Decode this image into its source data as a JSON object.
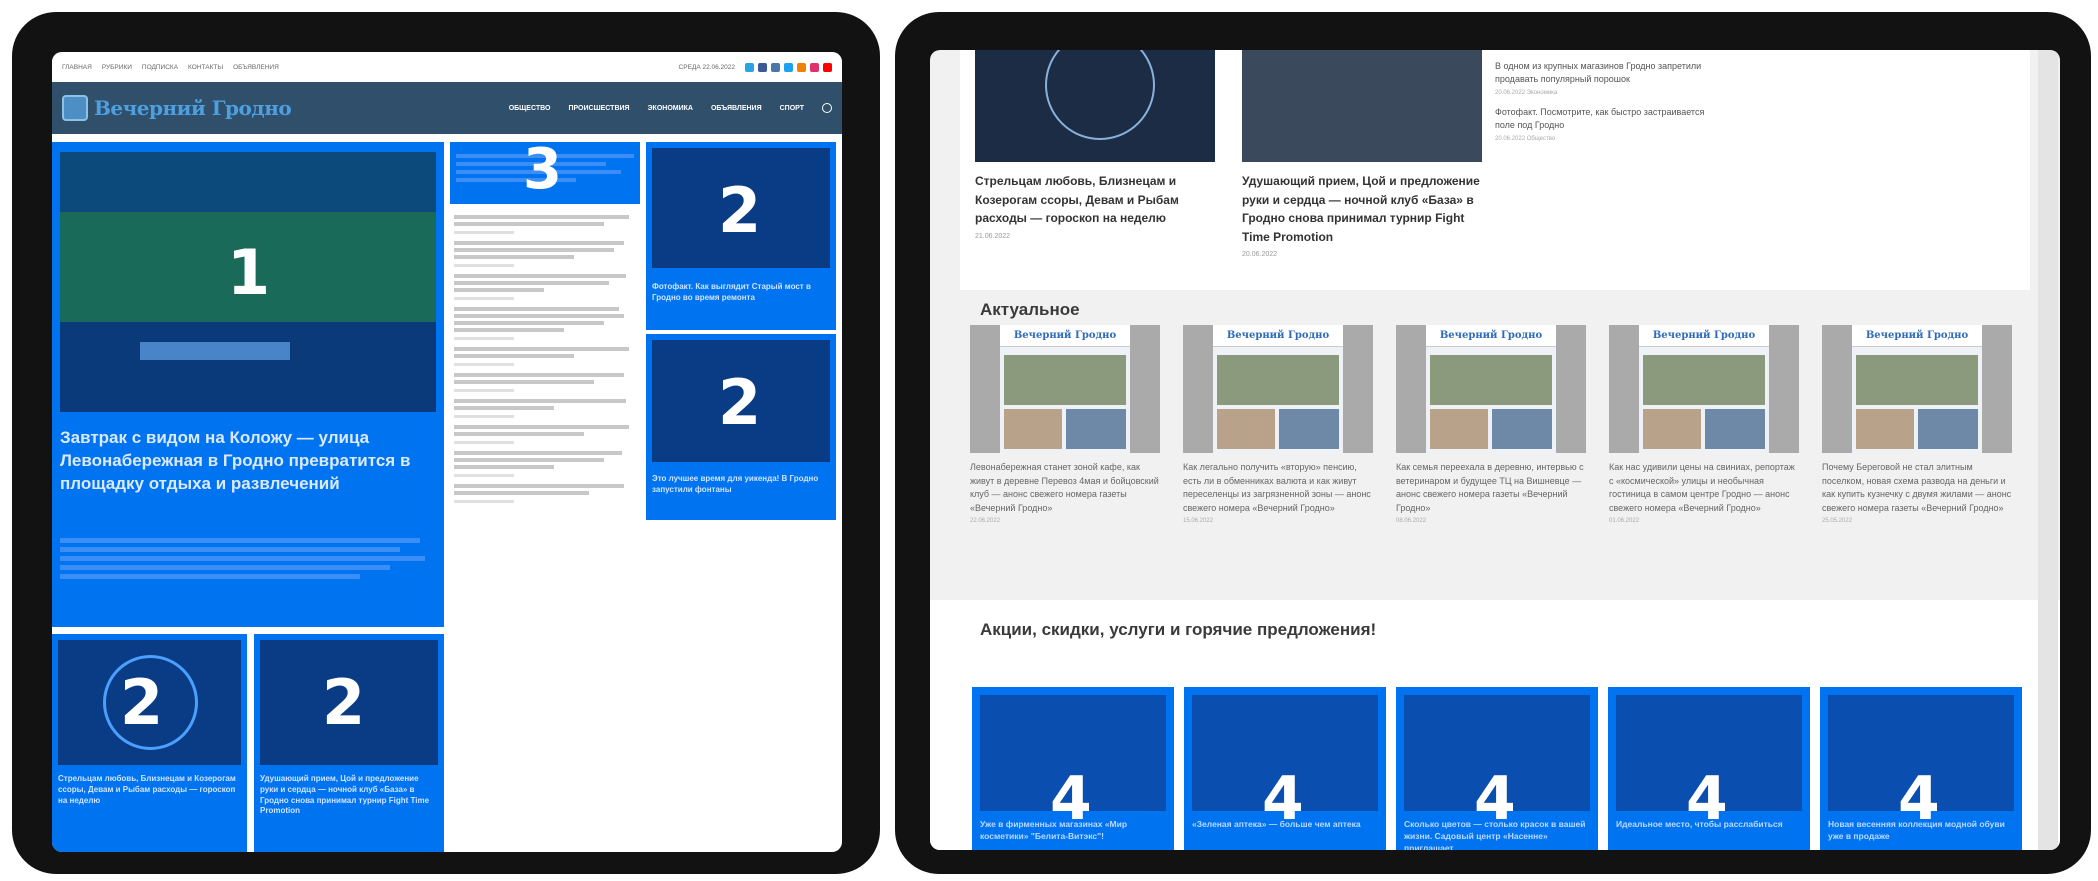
{
  "left": {
    "topbar": {
      "links": [
        "ГЛАВНАЯ",
        "РУБРИКИ",
        "ПОДПИСКА",
        "КОНТАКТЫ",
        "ОБЪЯВЛЕНИЯ"
      ],
      "date": "СРЕДА 22.06.2022"
    },
    "header": {
      "logo": "Вечерний Гродно",
      "nav": [
        "ОБЩЕСТВО",
        "ПРОИСШЕСТВИЯ",
        "ЭКОНОМИКА",
        "ОБЪЯВЛЕНИЯ",
        "СПОРТ"
      ]
    },
    "feature": {
      "number": "1",
      "title": "Завтрак с видом на Коложу — улица Левонабережная в Гродно превратится в площадку отдыха и развлечений"
    },
    "side_top_card": {
      "number": "2",
      "text": "Фотофакт. Как выглядит Старый мост в Гродно во время ремонта"
    },
    "side_bottom_card": {
      "number": "2",
      "text": "Это лучшее время для уикенда! В Гродно запустили фонтаны"
    },
    "bottom_card_1": {
      "number": "2",
      "text": "Стрельцам любовь, Близнецам и Козерогам ссоры, Девам и Рыбам расходы — гороскоп на неделю"
    },
    "bottom_card_2": {
      "number": "2",
      "text": "Удушающий прием, Цой и предложение руки и сердца — ночной клуб «База» в Гродно снова принимал турнир Fight Time Promotion"
    },
    "news_list": {
      "number": "3"
    }
  },
  "right": {
    "top_captions": [
      {
        "title": "Стрельцам любовь, Близнецам и Козерогам ссоры, Девам и Рыбам расходы — гороскоп на неделю",
        "date": "21.06.2022"
      },
      {
        "title": "Удушающий прием, Цой и предложение руки и сердца — ночной клуб «База» в Гродно снова принимал турнир Fight Time Promotion",
        "date": "20.06.2022"
      }
    ],
    "side_news": [
      {
        "title": "В одном из крупных магазинов Гродно запретили продавать популярный порошок",
        "meta": "20.06.2022 Экономика"
      },
      {
        "title": "Фотофакт. Посмотрите, как быстро застраивается поле под Гродно",
        "meta": "20.06.2022 Общество"
      }
    ],
    "actual_heading": "Актуальное",
    "actual_cards": [
      {
        "paper": "Вечерний Гродно",
        "text": "Левонабережная станет зоной кафе, как живут в деревне Перевоз 4мая и бойцовский клуб — анонс свежего номера газеты «Вечерний Гродно»",
        "date": "22.06.2022"
      },
      {
        "paper": "Вечерний Гродно",
        "text": "Как легально получить «вторую» пенсию, есть ли в обменниках валюта и как живут переселенцы из загрязненной зоны — анонс свежего номера «Вечерний Гродно»",
        "date": "15.06.2022"
      },
      {
        "paper": "Вечерний Гродно",
        "text": "Как семья переехала в деревню, интервью с ветеринаром и будущее ТЦ на Вишневце — анонс свежего номера газеты «Вечерний Гродно»",
        "date": "08.06.2022"
      },
      {
        "paper": "Вечерний Гродно",
        "text": "Как нас удивили цены на свиниах, репортаж с «космической» улицы и необычная гостиница в самом центре Гродно — анонс свежего номера «Вечерний Гродно»",
        "date": "01.06.2022"
      },
      {
        "paper": "Вечерний Гродно",
        "text": "Почему Береговой не стал элитным поселком, новая схема разводa на деньги и как купить кузнечку с двумя жилами — анонс свежего номера газеты «Вечерний Гродно»",
        "date": "25.05.2022"
      }
    ],
    "promo_heading": "Акции, скидки, услуги и горячие предложения!",
    "promo_cards": [
      {
        "number": "4",
        "text": "Уже в фирменных магазинах «Мир косметики» \"Белита-Витэкс\"!"
      },
      {
        "number": "4",
        "text": "«Зеленая аптека» — больше чем аптека"
      },
      {
        "number": "4",
        "text": "Сколько цветов — столько красок в вашей жизни. Садовый центр «Насенне» приглашает"
      },
      {
        "number": "4",
        "text": "Идеальное место, чтобы расслабиться"
      },
      {
        "number": "4",
        "text": "Новая весенняя коллекция модной обуви уже в продаже"
      }
    ]
  }
}
